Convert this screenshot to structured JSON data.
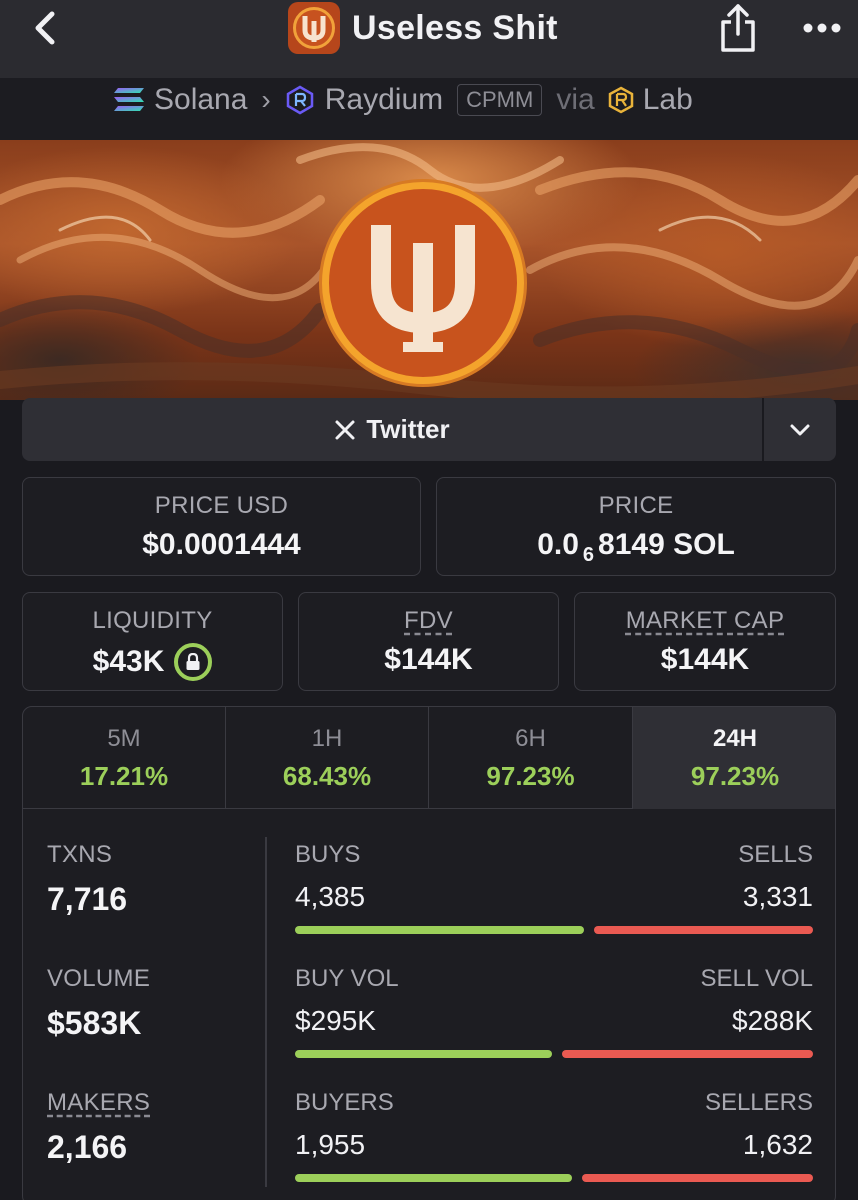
{
  "header": {
    "title": "Useless Shit",
    "back_icon": "chevron-left-icon",
    "share_icon": "share-icon",
    "more_icon": "more-horizontal-icon"
  },
  "breadcrumb": {
    "chain": "Solana",
    "dex": "Raydium",
    "pool_type": "CPMM",
    "via": "via",
    "launchpad": "Lab"
  },
  "social": {
    "twitter_label": "Twitter"
  },
  "prices": {
    "price_usd_label": "PRICE USD",
    "price_usd": "$0.0001444",
    "price_label": "PRICE",
    "price_sol_prefix": "0.0",
    "price_sol_zeros": "6",
    "price_sol_rest": "8149 SOL"
  },
  "market": {
    "liquidity_label": "LIQUIDITY",
    "liquidity": "$43K",
    "fdv_label": "FDV",
    "fdv": "$144K",
    "mcap_label": "MARKET CAP",
    "mcap": "$144K"
  },
  "timeframes": [
    {
      "label": "5M",
      "change": "17.21%"
    },
    {
      "label": "1H",
      "change": "68.43%"
    },
    {
      "label": "6H",
      "change": "97.23%"
    },
    {
      "label": "24H",
      "change": "97.23%",
      "active": true
    }
  ],
  "stats": {
    "txns_label": "TXNS",
    "txns": "7,716",
    "volume_label": "VOLUME",
    "volume": "$583K",
    "makers_label": "MAKERS",
    "makers": "2,166",
    "buys_label": "BUYS",
    "buys": "4,385",
    "sells_label": "SELLS",
    "sells": "3,331",
    "buy_share": 0.568,
    "buy_vol_label": "BUY VOL",
    "buy_vol": "$295K",
    "sell_vol_label": "SELL VOL",
    "sell_vol": "$288K",
    "buy_vol_share": 0.506,
    "buyers_label": "BUYERS",
    "buyers": "1,955",
    "sellers_label": "SELLERS",
    "sellers": "1,632",
    "buyer_share": 0.545
  },
  "colors": {
    "positive": "#9ccf5a",
    "negative": "#ea5a52",
    "background": "#1a1a1f"
  }
}
